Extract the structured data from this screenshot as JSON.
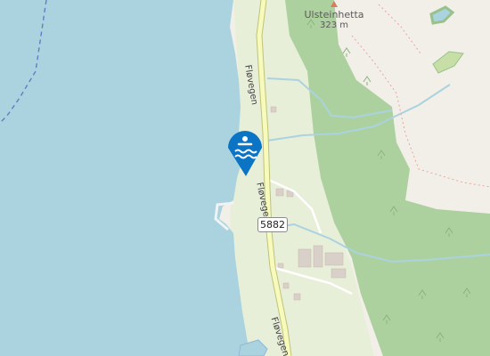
{
  "colors": {
    "water": "#aad3df",
    "land": "#f2efe9",
    "residential": "#e8efd8",
    "forest": "#add19e",
    "road": "#f6fabb",
    "road_casing": "#c0c27a",
    "marker": "#0b74c4",
    "building": "#d9d0c9"
  },
  "map": {
    "peak_name": "Ulsteinhetta",
    "peak_elevation": "323 m",
    "route_shield": "5882",
    "road_labels": [
      "Fløvegen",
      "Fløvegen",
      "Fløvegen"
    ]
  },
  "poi_marker": {
    "icon": "swimming-icon"
  }
}
